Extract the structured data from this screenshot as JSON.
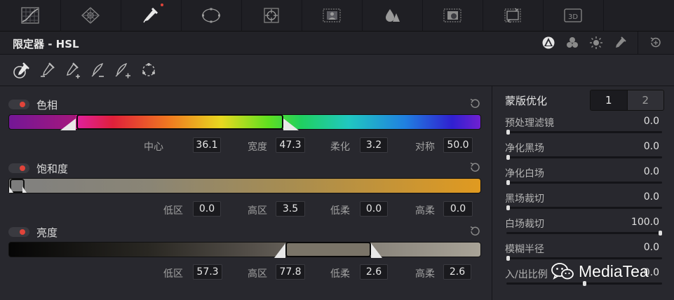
{
  "topbar": {
    "tools": [
      {
        "name": "curves-icon"
      },
      {
        "name": "color-warper-icon"
      },
      {
        "name": "qualifier-icon",
        "active": true
      },
      {
        "name": "window-icon"
      },
      {
        "name": "tracker-icon"
      },
      {
        "name": "magic-mask-icon"
      },
      {
        "name": "blur-icon"
      },
      {
        "name": "key-icon"
      },
      {
        "name": "sizing-icon"
      },
      {
        "name": "3d-icon",
        "text": "3D"
      }
    ]
  },
  "title": "限定器 - HSL",
  "sections": {
    "hue": {
      "label": "色相",
      "fields": [
        {
          "label": "中心",
          "value": "36.1"
        },
        {
          "label": "宽度",
          "value": "47.3"
        },
        {
          "label": "柔化",
          "value": "3.2"
        },
        {
          "label": "对称",
          "value": "50.0"
        }
      ]
    },
    "saturation": {
      "label": "饱和度",
      "fields": [
        {
          "label": "低区",
          "value": "0.0"
        },
        {
          "label": "高区",
          "value": "3.5"
        },
        {
          "label": "低柔",
          "value": "0.0"
        },
        {
          "label": "高柔",
          "value": "0.0"
        }
      ]
    },
    "luminance": {
      "label": "亮度",
      "fields": [
        {
          "label": "低区",
          "value": "57.3"
        },
        {
          "label": "高区",
          "value": "77.8"
        },
        {
          "label": "低柔",
          "value": "2.6"
        },
        {
          "label": "高柔",
          "value": "2.6"
        }
      ]
    }
  },
  "matte": {
    "title": "蒙版优化",
    "tabs": [
      "1",
      "2"
    ],
    "active_tab": "1",
    "rows": [
      {
        "label": "预处理滤镜",
        "value": "0.0",
        "level": 0.0
      },
      {
        "label": "净化黑场",
        "value": "0.0",
        "level": 0.0
      },
      {
        "label": "净化白场",
        "value": "0.0",
        "level": 0.0
      },
      {
        "label": "黑场裁切",
        "value": "0.0",
        "level": 0.0
      },
      {
        "label": "白场裁切",
        "value": "100.0",
        "level": 1.0
      },
      {
        "label": "模糊半径",
        "value": "0.0",
        "level": 0.0
      },
      {
        "label": "入/出比例",
        "value": "0.0",
        "level": 0.5
      }
    ]
  },
  "watermark": "MediaTea",
  "colors": {
    "accent_red": "#e0443a",
    "panel": "#28282e",
    "field": "#1a1a1e"
  }
}
